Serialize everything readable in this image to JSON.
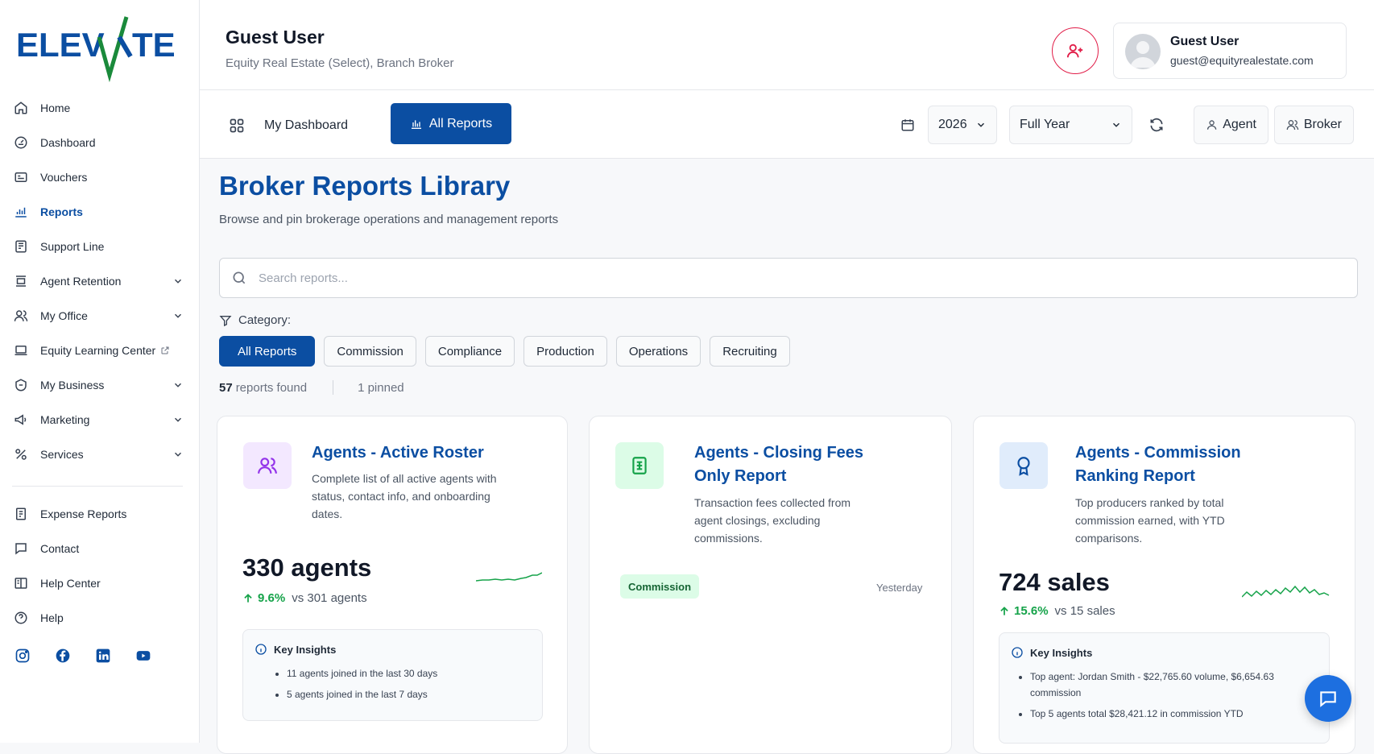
{
  "brand": {
    "logo_text": "ELEV",
    "logo_text_end": "TE",
    "accent": "#0b4ea2",
    "green": "#1a8a3b"
  },
  "sidebar": {
    "items": [
      {
        "label": "Home",
        "icon": "home-icon"
      },
      {
        "label": "Dashboard",
        "icon": "dashboard-icon"
      },
      {
        "label": "Vouchers",
        "icon": "voucher-icon"
      },
      {
        "label": "Reports",
        "icon": "reports-icon",
        "active": true
      },
      {
        "label": "Support Line",
        "icon": "support-icon"
      },
      {
        "label": "Agent Retention",
        "icon": "retention-icon",
        "expandable": true
      },
      {
        "label": "My Office",
        "icon": "office-icon",
        "expandable": true
      },
      {
        "label": "Equity Learning Center",
        "icon": "laptop-icon",
        "external": true
      },
      {
        "label": "My Business",
        "icon": "business-icon",
        "expandable": true
      },
      {
        "label": "Marketing",
        "icon": "megaphone-icon",
        "expandable": true
      },
      {
        "label": "Services",
        "icon": "percent-icon",
        "expandable": true
      }
    ],
    "bottom_items": [
      {
        "label": "Expense Reports",
        "icon": "expense-icon"
      },
      {
        "label": "Contact",
        "icon": "contact-icon"
      },
      {
        "label": "Help Center",
        "icon": "book-icon"
      },
      {
        "label": "Help",
        "icon": "help-icon"
      }
    ],
    "socials": [
      "instagram-icon",
      "facebook-icon",
      "linkedin-icon",
      "youtube-icon"
    ]
  },
  "header": {
    "user_name": "Guest User",
    "user_subtitle": "Equity Real Estate (Select), Branch Broker",
    "card_name": "Guest User",
    "card_email": "guest@equityrealestate.com"
  },
  "toolbar": {
    "dashboard_tab": "My Dashboard",
    "reports_tab": "All Reports",
    "year": "2026",
    "period": "Full Year",
    "agent_label": "Agent",
    "broker_label": "Broker"
  },
  "main": {
    "title": "Broker Reports Library",
    "subtitle": "Browse and pin brokerage operations and management reports",
    "search_placeholder": "Search reports...",
    "category_label": "Category:",
    "categories": [
      "All Reports",
      "Commission",
      "Compliance",
      "Production",
      "Operations",
      "Recruiting"
    ],
    "found_count": "57",
    "found_label": "reports found",
    "pinned_label": "1 pinned"
  },
  "cards": [
    {
      "title": "Agents - Active Roster",
      "description": "Complete list of all active agents with status, contact info, and onboarding dates.",
      "metric": "330 agents",
      "delta_pct": "9.6%",
      "delta_vs": "vs 301 agents",
      "insights_title": "Key Insights",
      "insights": [
        "11 agents joined in the last 30 days",
        "5 agents joined in the last 7 days"
      ]
    },
    {
      "title_line1": "Agents - Closing Fees",
      "title_line2": "Only Report",
      "description": "Transaction fees collected from agent closings, excluding commissions.",
      "tag": "Commission",
      "when": "Yesterday"
    },
    {
      "title_line1": "Agents - Commission",
      "title_line2": "Ranking Report",
      "description": "Top producers ranked by total commission earned, with YTD comparisons.",
      "metric": "724 sales",
      "delta_pct": "15.6%",
      "delta_vs": "vs 15 sales",
      "insights_title": "Key Insights",
      "insights": [
        "Top agent: Jordan Smith - $22,765.60 volume, $6,654.63 commission",
        "Top 5 agents total $28,421.12 in commission YTD"
      ]
    }
  ]
}
